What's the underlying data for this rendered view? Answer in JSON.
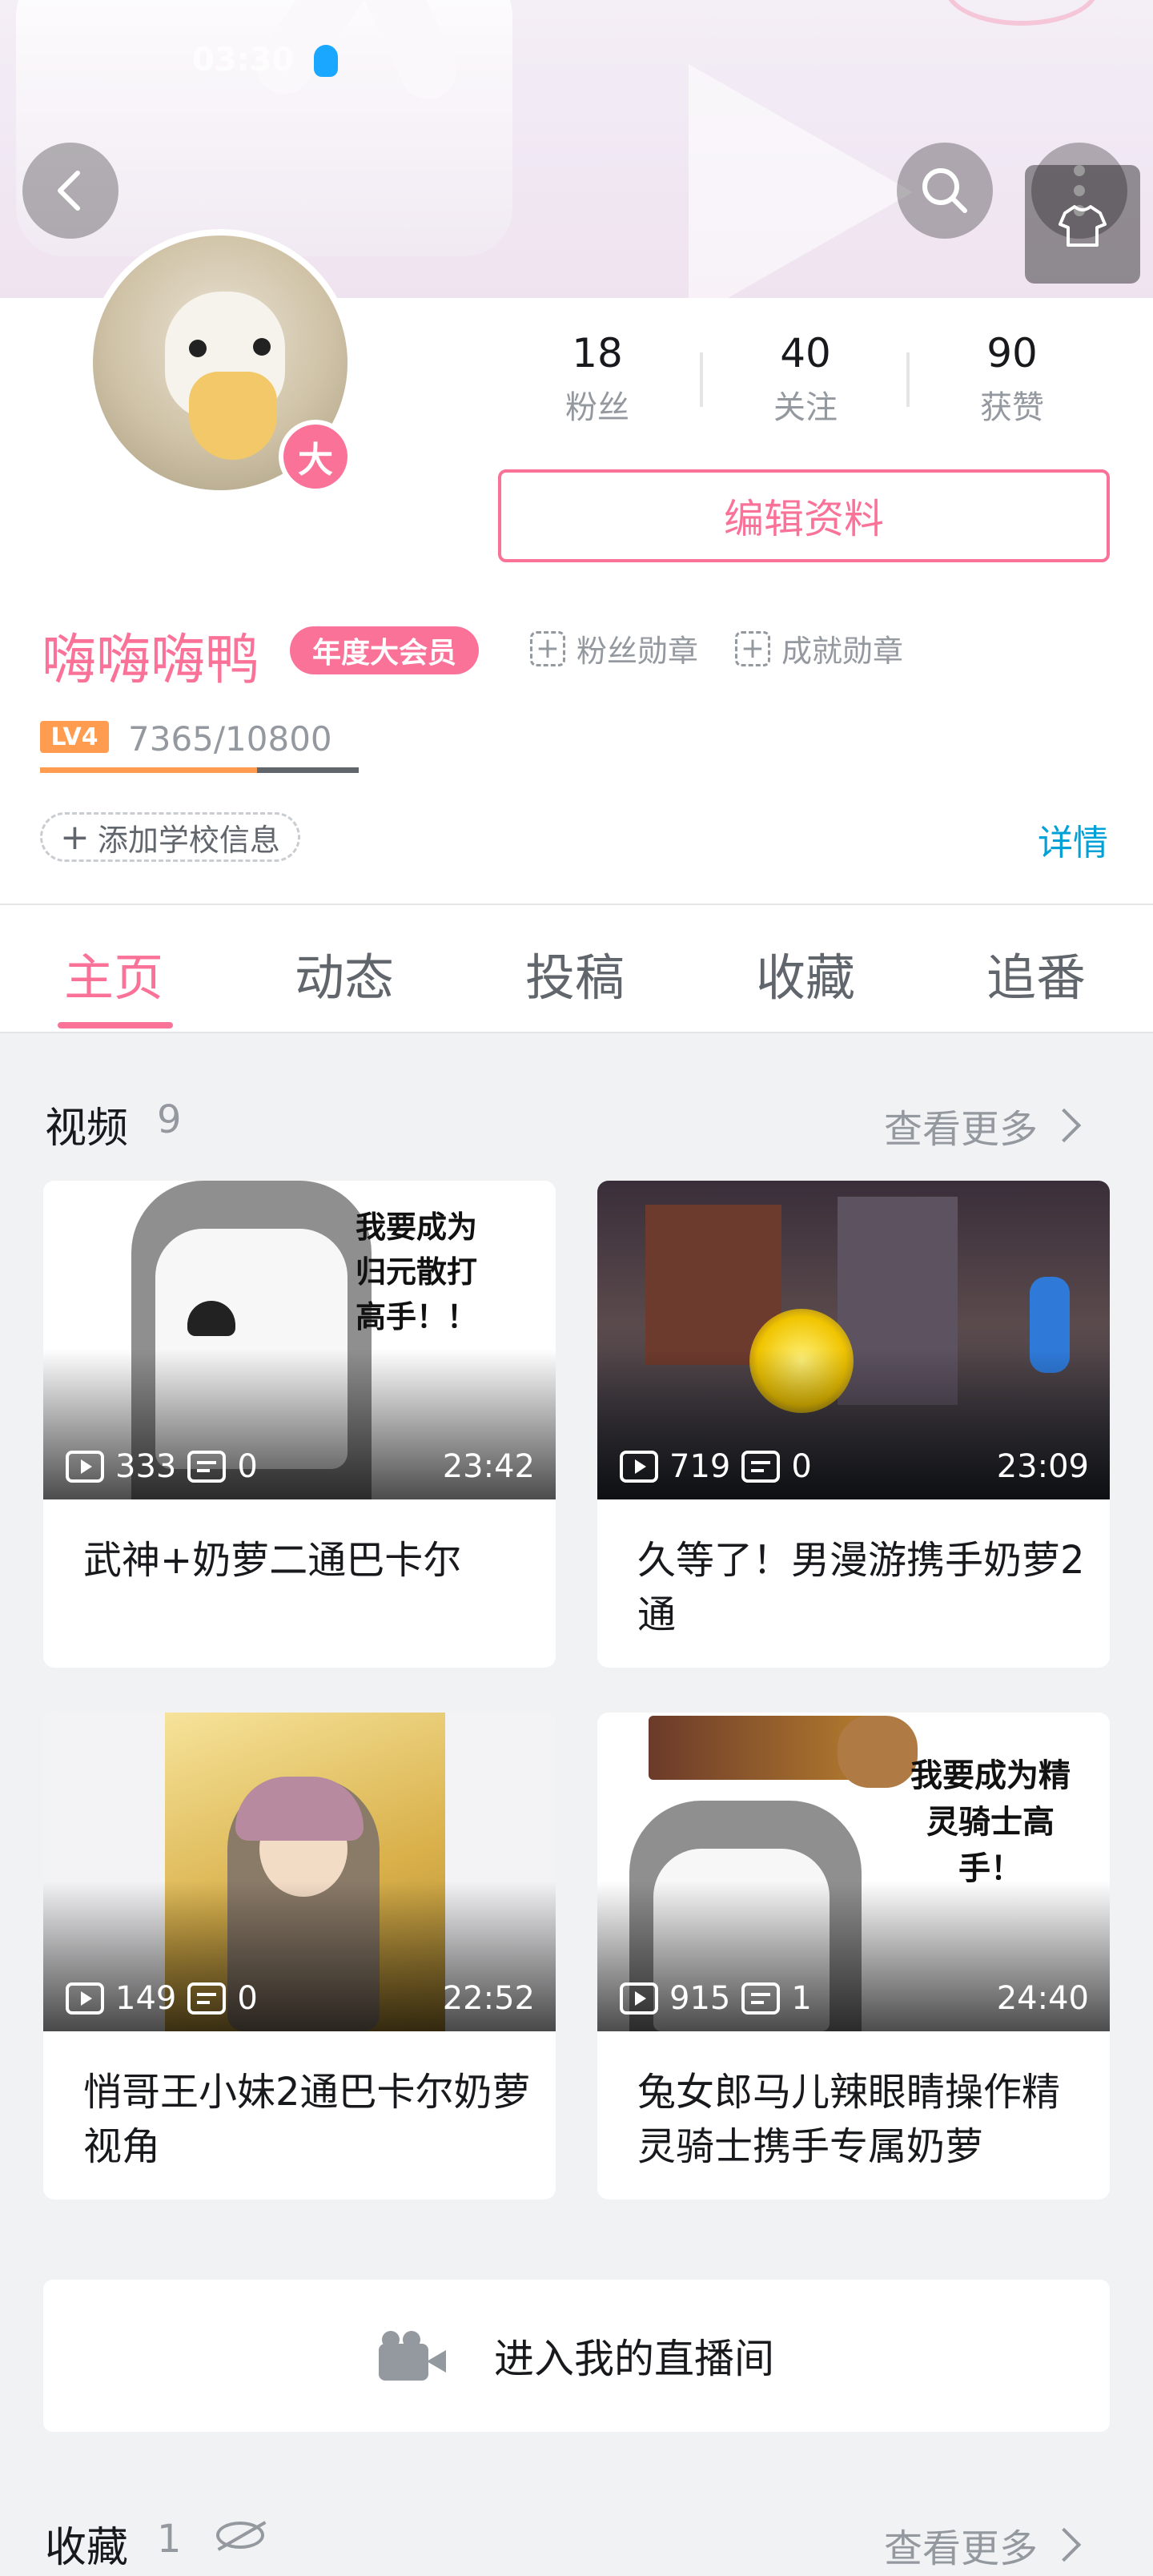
{
  "status_bar": {
    "time": "03:30"
  },
  "profile": {
    "vip_avatar_badge": "大",
    "stats": [
      {
        "value": "18",
        "label": "粉丝"
      },
      {
        "value": "40",
        "label": "关注"
      },
      {
        "value": "90",
        "label": "获赞"
      }
    ],
    "edit_button": "编辑资料",
    "username": "嗨嗨嗨鸭",
    "vip_label": "年度大会员",
    "fan_medal": "粉丝勋章",
    "achievement_medal": "成就勋章",
    "level": "LV4",
    "exp": "7365/10800",
    "exp_progress": 0.68,
    "add_school": "添加学校信息",
    "details": "详情"
  },
  "tabs": [
    {
      "label": "主页",
      "active": true
    },
    {
      "label": "动态",
      "active": false
    },
    {
      "label": "投稿",
      "active": false
    },
    {
      "label": "收藏",
      "active": false
    },
    {
      "label": "追番",
      "active": false
    }
  ],
  "videos_section": {
    "title": "视频",
    "count": "9",
    "more": "查看更多",
    "items": [
      {
        "plays": "333",
        "danmaku": "0",
        "duration": "23:42",
        "title": "武神+奶萝二通巴卡尔",
        "thumb_text": "我要成为归元散打高手！！"
      },
      {
        "plays": "719",
        "danmaku": "0",
        "duration": "23:09",
        "title": "久等了！男漫游携手奶萝2通",
        "thumb_text": ""
      },
      {
        "plays": "149",
        "danmaku": "0",
        "duration": "22:52",
        "title": "悄哥王小妹2通巴卡尔奶萝视角",
        "thumb_text": ""
      },
      {
        "plays": "915",
        "danmaku": "1",
        "duration": "24:40",
        "title": "兔女郎马儿辣眼睛操作精灵骑士携手专属奶萝",
        "thumb_text": "我要成为精灵骑士高手！"
      }
    ]
  },
  "live_room": {
    "label": "进入我的直播间"
  },
  "favorites_section": {
    "title": "收藏",
    "count": "1",
    "more": "查看更多"
  },
  "colors": {
    "accent": "#fb7299",
    "link": "#00a1d6",
    "level": "#ff9c4f"
  }
}
